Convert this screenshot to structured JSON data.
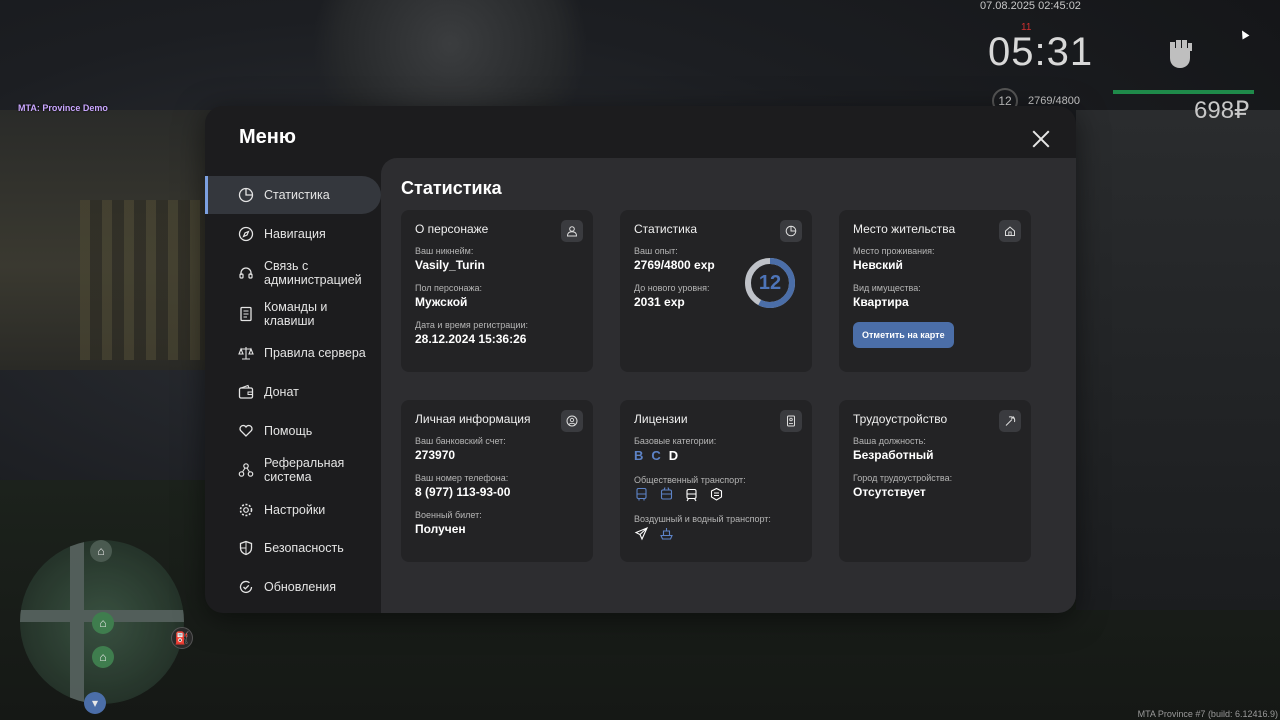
{
  "hud": {
    "datetime": "07.08.2025 02:45:02",
    "alert": "11",
    "time": "05:31",
    "level": "12",
    "exp": "2769/4800",
    "money": "698₽",
    "server_label": "MTA: Province Demo",
    "build": "MTA Province #7 (build: 6.12416.9)"
  },
  "menu": {
    "title": "Меню",
    "nav": [
      {
        "label": "Статистика",
        "icon": "pie-chart-icon",
        "active": true
      },
      {
        "label": "Навигация",
        "icon": "compass-icon"
      },
      {
        "label": "Связь с администрацией",
        "icon": "headset-icon"
      },
      {
        "label": "Команды и клавиши",
        "icon": "document-icon"
      },
      {
        "label": "Правила сервера",
        "icon": "scales-icon"
      },
      {
        "label": "Донат",
        "icon": "wallet-icon"
      },
      {
        "label": "Помощь",
        "icon": "heart-hand-icon"
      },
      {
        "label": "Реферальная система",
        "icon": "network-icon"
      },
      {
        "label": "Настройки",
        "icon": "gear-icon"
      },
      {
        "label": "Безопасность",
        "icon": "shield-icon"
      },
      {
        "label": "Обновления",
        "icon": "refresh-check-icon"
      }
    ]
  },
  "content": {
    "title": "Статистика",
    "character": {
      "title": "О персонаже",
      "nickname_label": "Ваш никнейм:",
      "nickname": "Vasily_Turin",
      "gender_label": "Пол персонажа:",
      "gender": "Мужской",
      "reg_label": "Дата и время регистрации:",
      "reg": "28.12.2024 15:36:26"
    },
    "stats": {
      "title": "Статистика",
      "exp_label": "Ваш опыт:",
      "exp": "2769/4800 exp",
      "next_label": "До нового уровня:",
      "next": "2031 exp",
      "level": "12",
      "progress": 0.577
    },
    "residence": {
      "title": "Место жительства",
      "place_label": "Место проживания:",
      "place": "Невский",
      "property_label": "Вид имущества:",
      "property": "Квартира",
      "map_button": "Отметить на карте"
    },
    "personal": {
      "title": "Личная информация",
      "bank_label": "Ваш банковский счет:",
      "bank": "273970",
      "phone_label": "Ваш номер телефона:",
      "phone": "8 (977) 113-93-00",
      "military_label": "Военный билет:",
      "military": "Получен"
    },
    "licenses": {
      "title": "Лицензии",
      "base_label": "Базовые категории:",
      "categories": [
        "B",
        "C",
        "D"
      ],
      "public_label": "Общественный транспорт:",
      "air_label": "Воздушный и водный транспорт:"
    },
    "employment": {
      "title": "Трудоустройство",
      "position_label": "Ваша должность:",
      "position": "Безработный",
      "city_label": "Город трудоустройства:",
      "city": "Отсутствует"
    }
  },
  "colors": {
    "accent": "#4b6ea8",
    "panel": "#1c1c1e",
    "content": "#2d2d30",
    "card": "#232325"
  }
}
